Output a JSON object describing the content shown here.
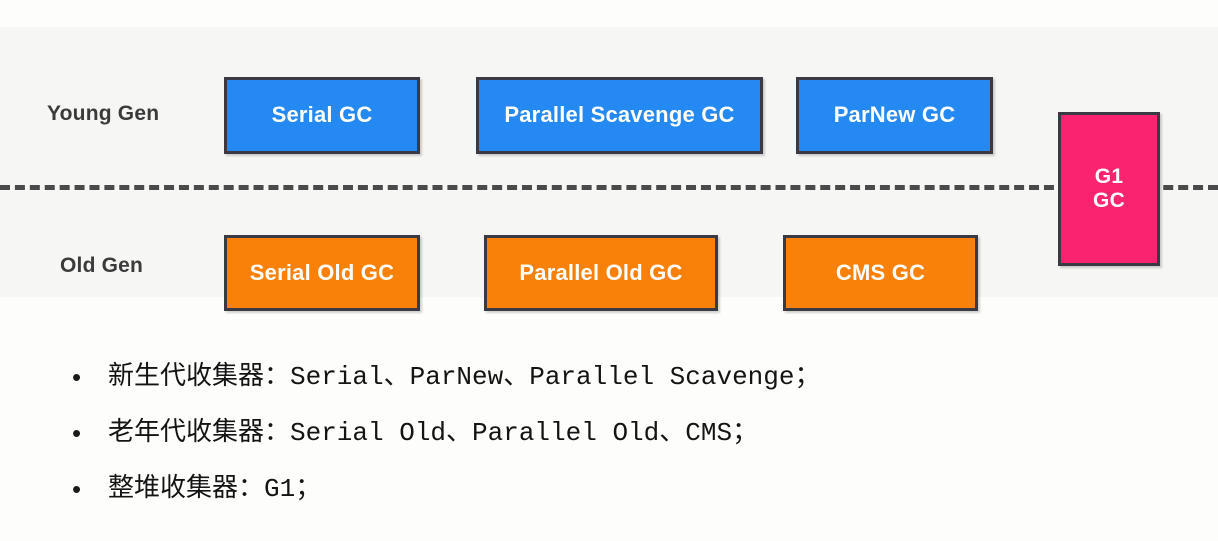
{
  "diagram": {
    "rows": [
      {
        "label": "Young Gen"
      },
      {
        "label": "Old Gen"
      }
    ],
    "young_gen_boxes": [
      {
        "label": "Serial GC",
        "color": "#2489f2"
      },
      {
        "label": "Parallel Scavenge GC",
        "color": "#2489f2"
      },
      {
        "label": "ParNew GC",
        "color": "#2489f2"
      }
    ],
    "old_gen_boxes": [
      {
        "label": "Serial Old GC",
        "color": "#f98109"
      },
      {
        "label": "Parallel Old GC",
        "color": "#f98109"
      },
      {
        "label": "CMS GC",
        "color": "#f98109"
      }
    ],
    "whole_heap_box": {
      "line1": "G1",
      "line2": "GC",
      "color": "#f92370"
    },
    "divider_color": "#4a4a4a",
    "panel_background": "#f6f7f4"
  },
  "bullets": [
    {
      "marker": "•",
      "text": "新生代收集器：Serial、ParNew、Parallel Scavenge；"
    },
    {
      "marker": "•",
      "text": "老年代收集器：Serial Old、Parallel Old、CMS；"
    },
    {
      "marker": "•",
      "text": "整堆收集器：G1；"
    }
  ]
}
